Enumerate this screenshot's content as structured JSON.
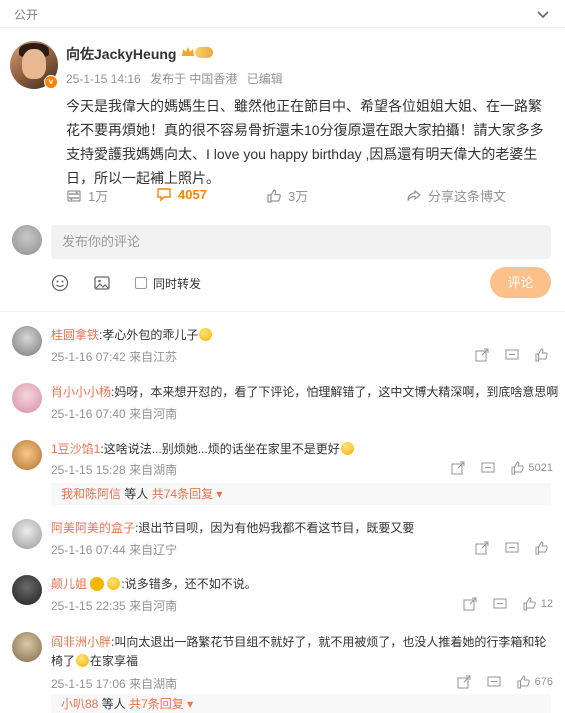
{
  "header": {
    "visibility": "公开"
  },
  "post": {
    "author": "向佐JackyHeung",
    "time": "25-1-15 14:16",
    "source": "发布于 中国香港",
    "edited": "已编辑",
    "content": "今天是我偉大的媽媽生日、雖然他正在節目中、希望各位姐姐大姐、在一路繁花不要再煩她！真的很不容易骨折還未10分復原還在跟大家拍攝！請大家多多支持愛護我媽媽向太、I love you happy birthday ,因爲還有明天偉大的老婆生日，所以一起補上照片。",
    "reposts": "1万",
    "comments": "4057",
    "likes": "3万",
    "share": "分享这条博文"
  },
  "composer": {
    "placeholder": "发布你的评论",
    "repost_label": "同时转发",
    "submit_label": "评论"
  },
  "comments": [
    {
      "nick": "桂圆拿铁",
      "text": ":孝心外包的乖儿子",
      "time": "25-1-16 07:42",
      "location": "来自江苏",
      "like_count": ""
    },
    {
      "nick": "肖小小小杨",
      "text": ":妈呀，本来想开怼的，看了下评论，怕理解错了，这中文博大精深啊，到底啥意思啊",
      "time": "25-1-16 07:40",
      "location": "来自河南",
      "like_count": ""
    },
    {
      "nick": "1豆沙馅1",
      "text": ":这啥说法...别烦她...烦的话坐在家里不是更好",
      "time": "25-1-15 15:28",
      "location": "来自湖南",
      "like_count": "5021",
      "reply": {
        "name": "我和陈阿信",
        "mid": "等人",
        "count": "共74条回复"
      }
    },
    {
      "nick": "阿美阿美的盒子",
      "text": ":退出节目呗，因为有他妈我都不看这节目，既要又要",
      "time": "25-1-16 07:44",
      "location": "来自辽宁",
      "like_count": ""
    },
    {
      "nick": "颠儿姐",
      "text": ":说多错多，还不如不说。",
      "time": "25-1-15 22:35",
      "location": "来自河南",
      "like_count": "12"
    },
    {
      "nick": "阎非洲小胖",
      "text": ":叫向太退出一路繁花节目组不就好了，就不用被烦了，也没人推着她的行李箱和轮椅了",
      "text2": "在家享福",
      "time": "25-1-15 17:06",
      "location": "来自湖南",
      "like_count": "676",
      "reply": {
        "name": "小叭88",
        "mid": "等人",
        "count": "共7条回复"
      }
    }
  ]
}
